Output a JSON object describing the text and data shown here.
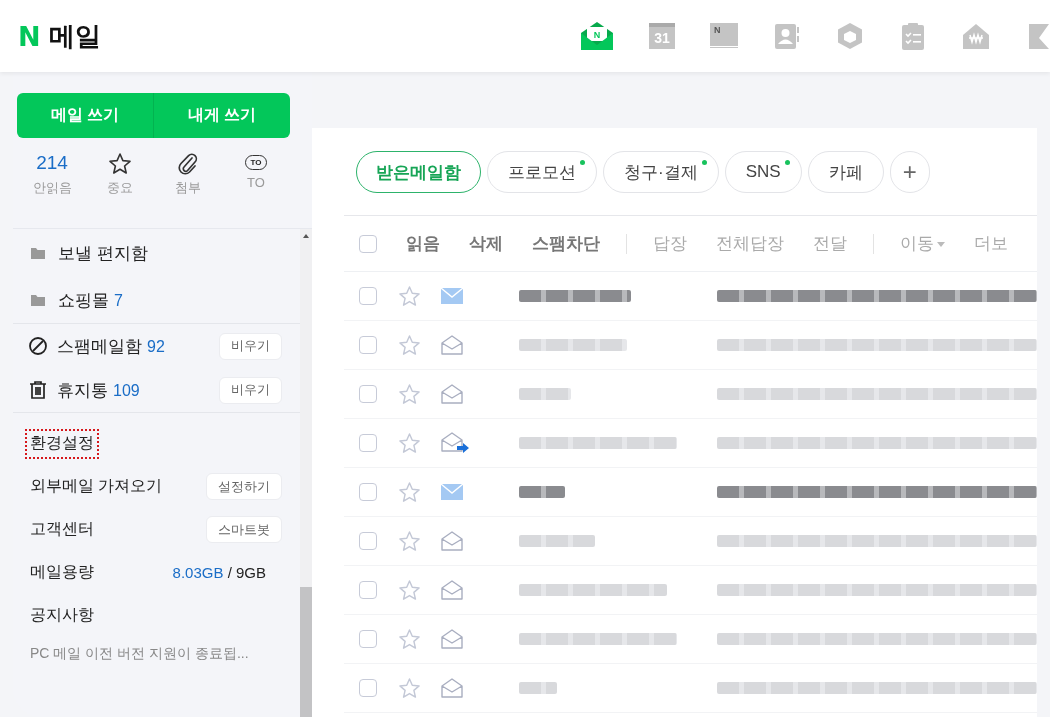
{
  "logo": {
    "mark": "N",
    "title": "메일"
  },
  "apps": [
    {
      "kind": "mail",
      "label": "N",
      "selected": true
    },
    {
      "kind": "calendar",
      "label": "31",
      "selected": false
    },
    {
      "kind": "memo",
      "label": "N",
      "selected": false
    },
    {
      "kind": "contacts",
      "selected": false
    },
    {
      "kind": "box",
      "selected": false
    },
    {
      "kind": "todo",
      "selected": false
    },
    {
      "kind": "household",
      "selected": false
    },
    {
      "kind": "bookmark",
      "selected": false
    }
  ],
  "compose": [
    "메일 쓰기",
    "내게 쓰기"
  ],
  "quick": [
    {
      "kind": "count",
      "value": "214",
      "label": "안읽음"
    },
    {
      "kind": "star",
      "label": "중요"
    },
    {
      "kind": "clip",
      "label": "첨부"
    },
    {
      "kind": "to",
      "label": "TO",
      "badge": "TO"
    }
  ],
  "folders": [
    {
      "name": "보낼 편지함"
    },
    {
      "name": "쇼핑몰",
      "count": "7"
    }
  ],
  "system_folders": [
    {
      "kind": "spam",
      "name": "스팸메일함",
      "count": "92",
      "action": "비우기"
    },
    {
      "kind": "trash",
      "name": "휴지통",
      "count": "109",
      "action": "비우기"
    }
  ],
  "settings": [
    {
      "kind": "title",
      "label": "환경설정",
      "highlighted": true
    },
    {
      "kind": "button",
      "label": "외부메일 가져오기",
      "action": "설정하기"
    },
    {
      "kind": "button",
      "label": "고객센터",
      "action": "스마트봇"
    },
    {
      "kind": "quota",
      "label": "메일용량",
      "used": "8.03GB",
      "sep": "/",
      "total": "9GB"
    },
    {
      "kind": "title",
      "label": "공지사항",
      "highlighted": false
    },
    {
      "kind": "notice",
      "label": "PC 메일 이전 버전 지원이 종료됩..."
    }
  ],
  "tabs": [
    {
      "label": "받은메일함",
      "selected": true,
      "new": false
    },
    {
      "label": "프로모션",
      "selected": false,
      "new": true
    },
    {
      "label": "청구·결제",
      "selected": false,
      "new": true
    },
    {
      "label": "SNS",
      "selected": false,
      "new": true
    },
    {
      "label": "카페",
      "selected": false,
      "new": false
    }
  ],
  "add_tab": "+",
  "toolbar": [
    {
      "label": "읽음",
      "kind": "strong"
    },
    {
      "label": "삭제",
      "kind": "strong"
    },
    {
      "label": "스팸차단",
      "kind": "strong"
    },
    {
      "kind": "sep"
    },
    {
      "label": "답장",
      "kind": "light"
    },
    {
      "label": "전체답장",
      "kind": "light"
    },
    {
      "label": "전달",
      "kind": "light"
    },
    {
      "kind": "sep"
    },
    {
      "label": "이동",
      "kind": "menu"
    },
    {
      "label": "더보",
      "kind": "light"
    }
  ],
  "select_all": {
    "checked": false
  },
  "mails": [
    {
      "kind": "unread",
      "checked": false
    },
    {
      "kind": "read",
      "checked": false
    },
    {
      "kind": "read",
      "checked": false
    },
    {
      "kind": "forwarded",
      "checked": false
    },
    {
      "kind": "unread",
      "checked": false
    },
    {
      "kind": "read",
      "checked": false
    },
    {
      "kind": "read",
      "checked": false
    },
    {
      "kind": "read",
      "checked": false
    },
    {
      "kind": "read",
      "checked": false
    }
  ]
}
